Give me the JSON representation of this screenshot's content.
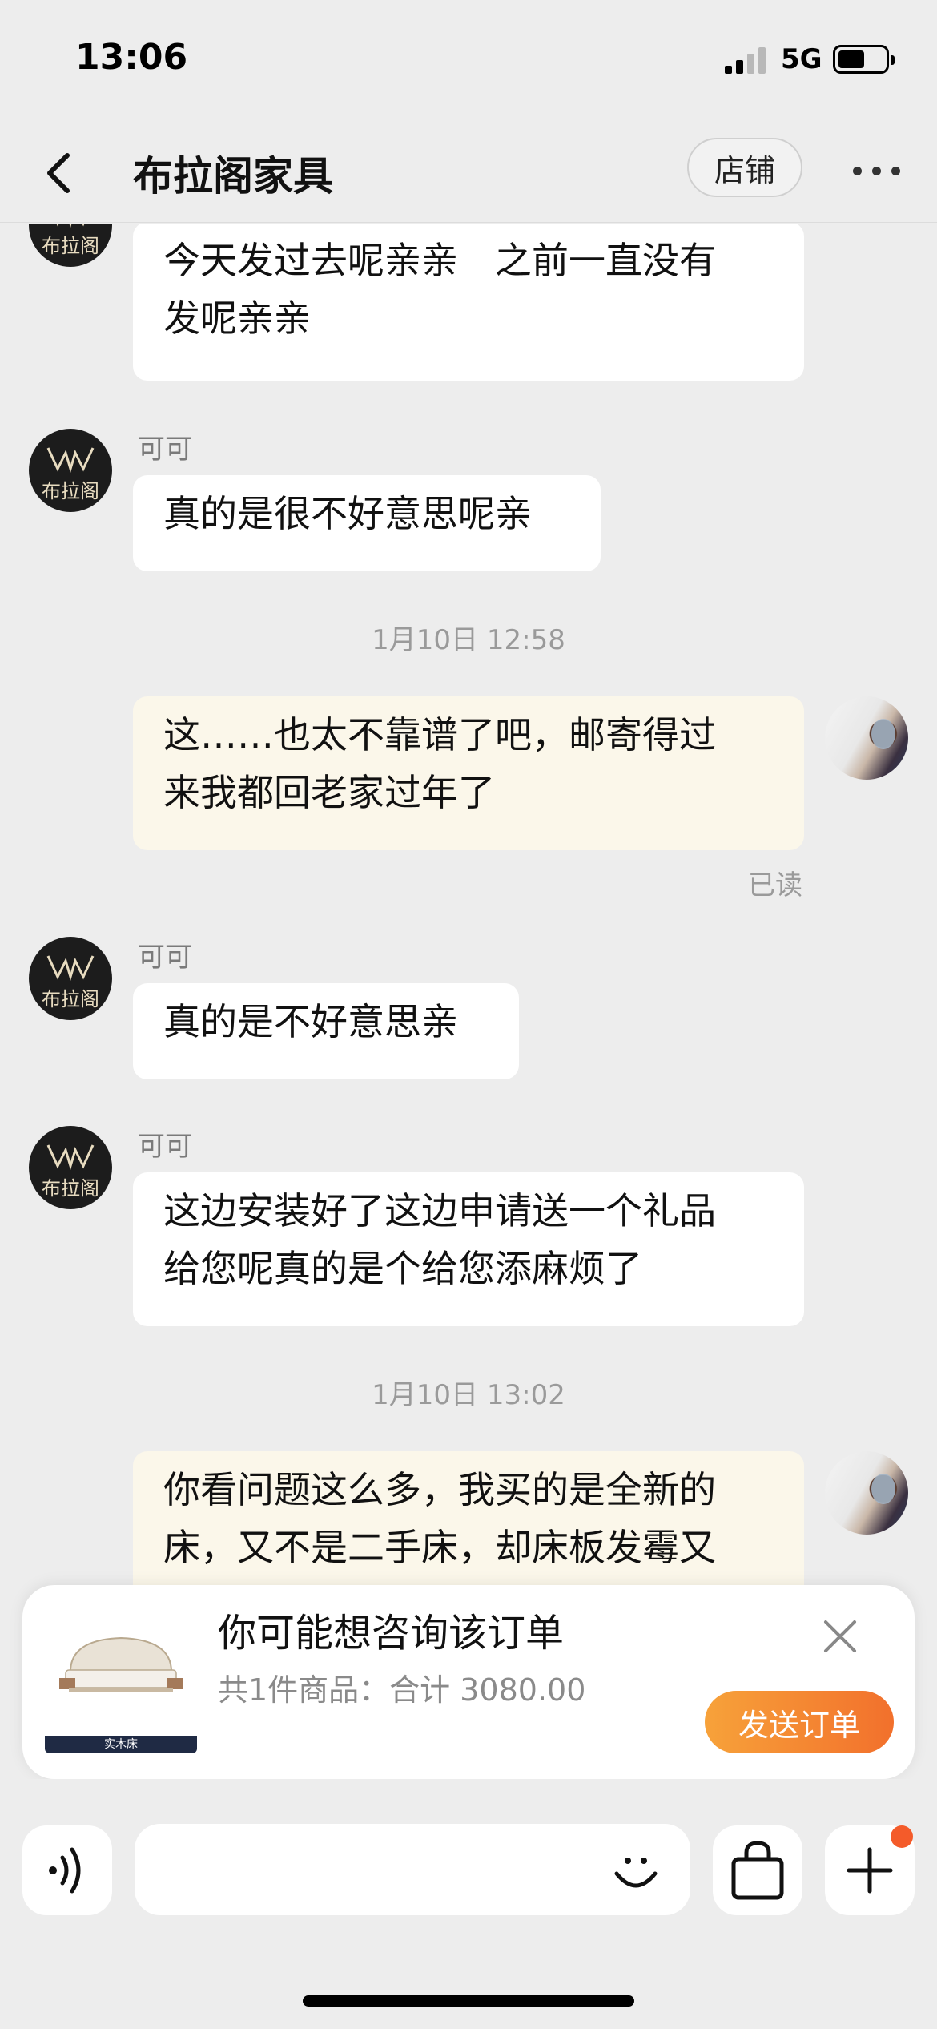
{
  "status_bar": {
    "time": "13:06",
    "network": "5G"
  },
  "header": {
    "title": "布拉阁家具",
    "shop_button_label": "店铺"
  },
  "shop": {
    "avatar_logo_text": "布拉阁"
  },
  "messages": [
    {
      "from": "shop",
      "sender": "",
      "lines": [
        "今天发过去呢亲亲　之前一直没有",
        "发呢亲亲"
      ]
    },
    {
      "from": "shop",
      "sender": "可可",
      "lines": [
        "真的是很不好意思呢亲"
      ]
    },
    {
      "type": "timestamp",
      "text": "1月10日 12:58"
    },
    {
      "from": "me",
      "lines": [
        "这……也太不靠谱了吧，邮寄得过",
        "来我都回老家过年了"
      ],
      "status": "已读"
    },
    {
      "from": "shop",
      "sender": "可可",
      "lines": [
        "真的是不好意思亲"
      ]
    },
    {
      "from": "shop",
      "sender": "可可",
      "lines": [
        "这边安装好了这边申请送一个礼品",
        "给您呢真的是个给您添麻烦了"
      ]
    },
    {
      "type": "timestamp",
      "text": "1月10日 13:02"
    },
    {
      "from": "me",
      "lines": [
        "你看问题这么多，我买的是全新的",
        "床，又不是二手床，却床板发霉又"
      ]
    }
  ],
  "order_card": {
    "title": "你可能想咨询该订单",
    "summary": "共1件商品：合计 3080.00",
    "thumb_label": "实木床",
    "send_button_label": "发送订单"
  },
  "input": {
    "placeholder": ""
  },
  "icons": {
    "back": "chevron-left-icon",
    "more": "more-dots-icon",
    "close": "close-icon",
    "voice": "voice-icon",
    "emoji": "emoji-icon",
    "bag": "shopping-bag-icon",
    "plus": "plus-icon"
  },
  "colors": {
    "background": "#ededed",
    "my_bubble": "#fbf7ea",
    "their_bubble": "#ffffff",
    "accent": "#f2702c",
    "notify_dot": "#f45b2a"
  }
}
